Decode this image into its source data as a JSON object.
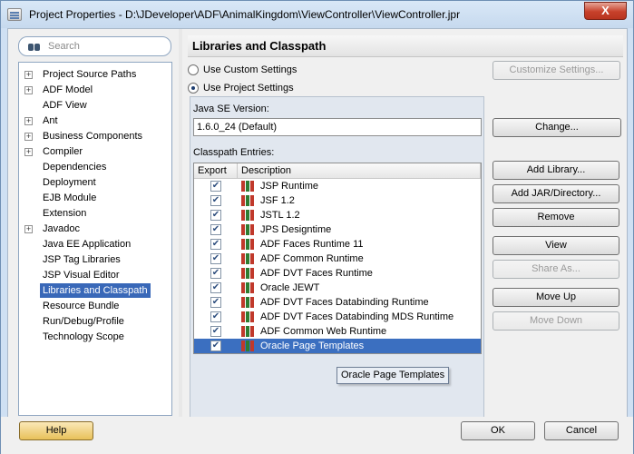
{
  "window": {
    "title": "Project Properties - D:\\JDeveloper\\ADF\\AnimalKingdom\\ViewController\\ViewController.jpr",
    "close_label": "X"
  },
  "search": {
    "placeholder": "Search",
    "icon": "binoculars-icon"
  },
  "tree": {
    "items": [
      {
        "label": "Project Source Paths",
        "expandable": true
      },
      {
        "label": "ADF Model",
        "expandable": true
      },
      {
        "label": "ADF View",
        "expandable": false
      },
      {
        "label": "Ant",
        "expandable": true
      },
      {
        "label": "Business Components",
        "expandable": true
      },
      {
        "label": "Compiler",
        "expandable": true
      },
      {
        "label": "Dependencies",
        "expandable": false
      },
      {
        "label": "Deployment",
        "expandable": false
      },
      {
        "label": "EJB Module",
        "expandable": false
      },
      {
        "label": "Extension",
        "expandable": false
      },
      {
        "label": "Javadoc",
        "expandable": true
      },
      {
        "label": "Java EE Application",
        "expandable": false
      },
      {
        "label": "JSP Tag Libraries",
        "expandable": false
      },
      {
        "label": "JSP Visual Editor",
        "expandable": false
      },
      {
        "label": "Libraries and Classpath",
        "expandable": false,
        "selected": true
      },
      {
        "label": "Resource Bundle",
        "expandable": false
      },
      {
        "label": "Run/Debug/Profile",
        "expandable": false
      },
      {
        "label": "Technology Scope",
        "expandable": false
      }
    ]
  },
  "main": {
    "title": "Libraries and Classpath",
    "radio_custom": "Use Custom Settings",
    "radio_project": "Use Project Settings",
    "selected_setting": "Use Project Settings",
    "customize_button": "Customize Settings...",
    "java_se_label": "Java SE Version:",
    "java_se_value": "1.6.0_24 (Default)",
    "change_button": "Change...",
    "classpath_label": "Classpath Entries:",
    "columns": [
      "Export",
      "Description"
    ],
    "entries": [
      {
        "label": "JSP Runtime",
        "export": true
      },
      {
        "label": "JSF 1.2",
        "export": true
      },
      {
        "label": "JSTL 1.2",
        "export": true
      },
      {
        "label": "JPS Designtime",
        "export": true
      },
      {
        "label": "ADF Faces Runtime 11",
        "export": true
      },
      {
        "label": "ADF Common Runtime",
        "export": true
      },
      {
        "label": "ADF DVT Faces Runtime",
        "export": true
      },
      {
        "label": "Oracle JEWT",
        "export": true
      },
      {
        "label": "ADF DVT Faces Databinding Runtime",
        "export": true
      },
      {
        "label": "ADF DVT Faces Databinding MDS Runtime",
        "export": true
      },
      {
        "label": "ADF Common Web Runtime",
        "export": true
      },
      {
        "label": "Oracle Page Templates",
        "export": true,
        "selected": true
      }
    ],
    "tooltip": "Oracle Page Templates",
    "buttons": {
      "add_library": "Add Library...",
      "add_jar": "Add JAR/Directory...",
      "remove": "Remove",
      "view": "View",
      "share_as": "Share As...",
      "move_up": "Move Up",
      "move_down": "Move Down"
    }
  },
  "footer": {
    "help": "Help",
    "ok": "OK",
    "cancel": "Cancel"
  },
  "colors": {
    "selection": "#3968b8",
    "close_button": "#c7412b",
    "window_frame": "#cfe0f3"
  }
}
